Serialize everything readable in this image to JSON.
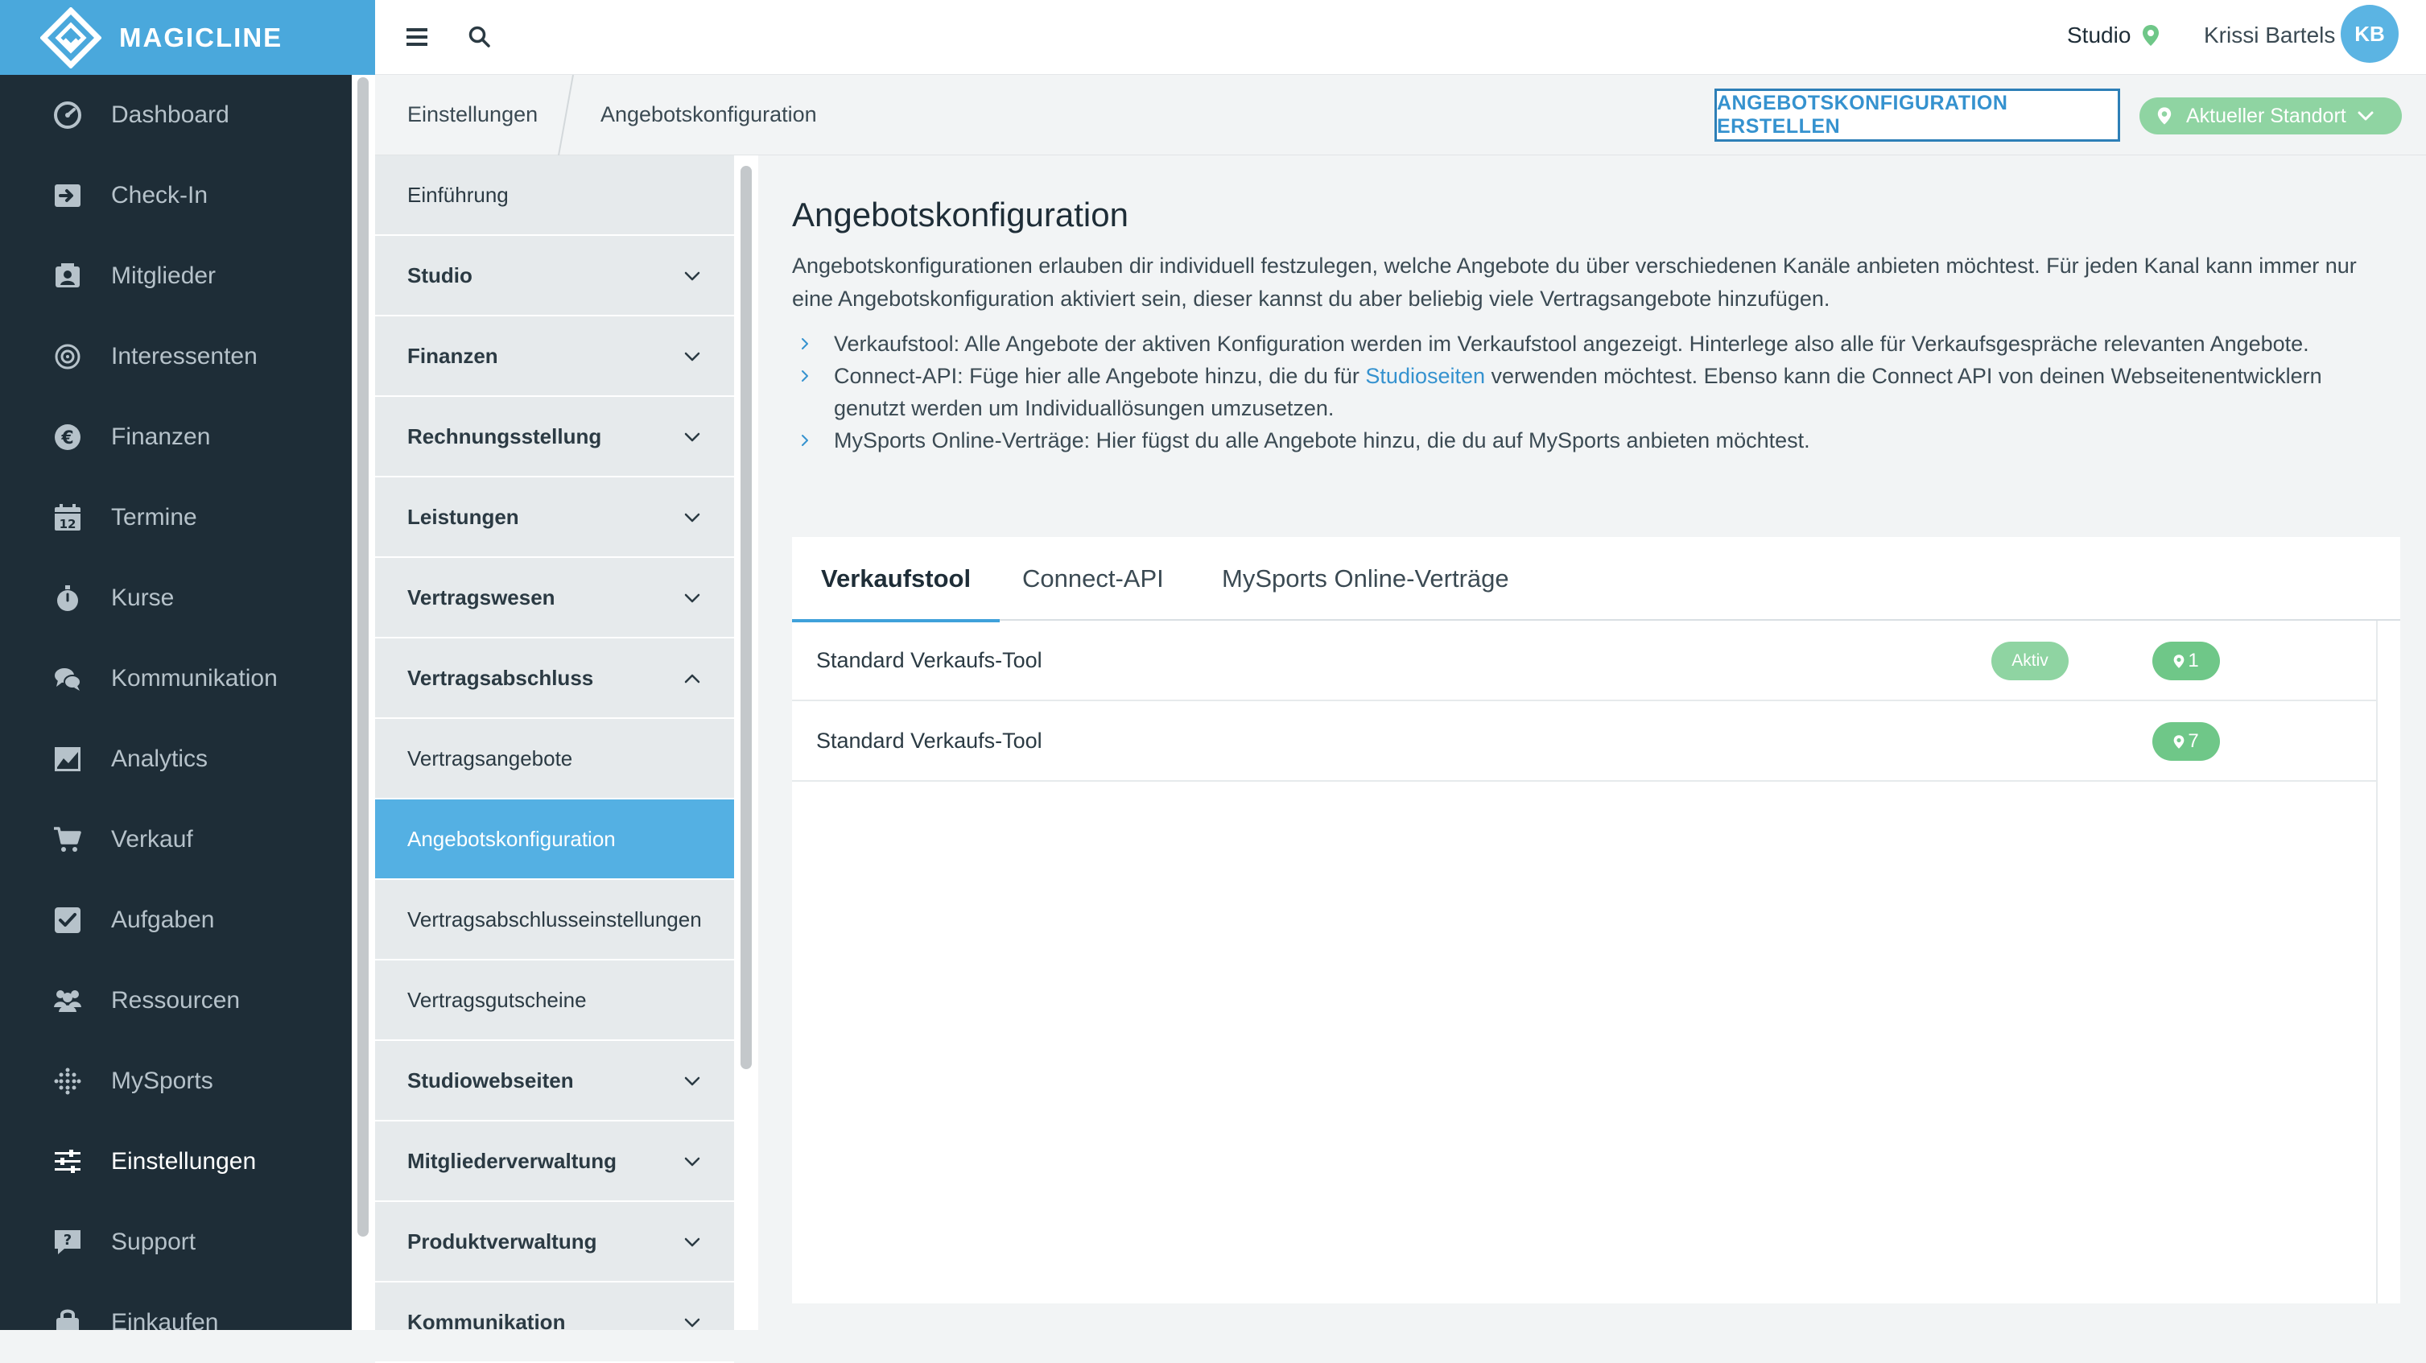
{
  "brand": {
    "name": "MAGICLINE"
  },
  "sidebar": {
    "items": [
      {
        "label": "Dashboard",
        "icon": "dashboard-icon"
      },
      {
        "label": "Check-In",
        "icon": "check-in-icon"
      },
      {
        "label": "Mitglieder",
        "icon": "members-icon"
      },
      {
        "label": "Interessenten",
        "icon": "prospects-icon"
      },
      {
        "label": "Finanzen",
        "icon": "euro-icon"
      },
      {
        "label": "Termine",
        "icon": "calendar-icon"
      },
      {
        "label": "Kurse",
        "icon": "stopwatch-icon"
      },
      {
        "label": "Kommunikation",
        "icon": "chat-icon"
      },
      {
        "label": "Analytics",
        "icon": "analytics-icon"
      },
      {
        "label": "Verkauf",
        "icon": "cart-icon"
      },
      {
        "label": "Aufgaben",
        "icon": "task-check-icon"
      },
      {
        "label": "Ressourcen",
        "icon": "resources-icon"
      },
      {
        "label": "MySports",
        "icon": "mysports-icon"
      },
      {
        "label": "Einstellungen",
        "icon": "settings-sliders-icon"
      },
      {
        "label": "Support",
        "icon": "support-icon"
      },
      {
        "label": "Einkaufen",
        "icon": "shopping-icon"
      }
    ],
    "calendar_day": "12"
  },
  "topbar": {
    "studio_label": "Studio",
    "user_name": "Krissi Bartels",
    "user_initials": "KB"
  },
  "breadcrumb": {
    "parent": "Einstellungen",
    "current": "Angebotskonfiguration"
  },
  "actions": {
    "create_label": "ANGEBOTSKONFIGURATION ERSTELLEN",
    "location_label": "Aktueller Standort"
  },
  "submenu": {
    "items": [
      {
        "label": "Einführung",
        "group": false
      },
      {
        "label": "Studio",
        "group": true,
        "expanded": false
      },
      {
        "label": "Finanzen",
        "group": true,
        "expanded": false
      },
      {
        "label": "Rechnungsstellung",
        "group": true,
        "expanded": false
      },
      {
        "label": "Leistungen",
        "group": true,
        "expanded": false
      },
      {
        "label": "Vertragswesen",
        "group": true,
        "expanded": false
      },
      {
        "label": "Vertragsabschluss",
        "group": true,
        "expanded": true
      },
      {
        "label": "Vertragsangebote",
        "group": false
      },
      {
        "label": "Angebotskonfiguration",
        "group": false,
        "active": true
      },
      {
        "label": "Vertragsabschlusseinstellungen",
        "group": false
      },
      {
        "label": "Vertragsgutscheine",
        "group": false
      },
      {
        "label": "Studiowebseiten",
        "group": true,
        "expanded": false
      },
      {
        "label": "Mitgliederverwaltung",
        "group": true,
        "expanded": false
      },
      {
        "label": "Produktverwaltung",
        "group": true,
        "expanded": false
      },
      {
        "label": "Kommunikation",
        "group": true,
        "expanded": false
      }
    ]
  },
  "page": {
    "title": "Angebotskonfiguration",
    "intro": "Angebotskonfigurationen erlauben dir individuell festzulegen, welche Angebote du über verschiedenen Kanäle anbieten möchtest. Für jeden Kanal kann immer nur eine Angebotskonfiguration aktiviert sein, dieser kannst du aber beliebig viele Vertragsangebote hinzufügen.",
    "bullet1": "Verkaufstool: Alle Angebote der aktiven Konfiguration werden im Verkaufstool angezeigt. Hinterlege also alle für Verkaufsgespräche relevanten Angebote.",
    "bullet2_pre": "Connect-API: Füge hier alle Angebote hinzu, die du für ",
    "bullet2_link": "Studioseiten",
    "bullet2_post": " verwenden möchtest. Ebenso kann die Connect API von deinen Webseitenentwicklern genutzt werden um Individuallösungen umzusetzen.",
    "bullet3": "MySports Online-Verträge: Hier fügst du alle Angebote hinzu, die du auf MySports anbieten möchtest."
  },
  "tabs": [
    {
      "label": "Verkaufstool",
      "active": true
    },
    {
      "label": "Connect-API",
      "active": false
    },
    {
      "label": "MySports Online-Verträge",
      "active": false
    }
  ],
  "rows": [
    {
      "name": "Standard Verkaufs-Tool",
      "status": "Aktiv",
      "locations": "1"
    },
    {
      "name": "Standard Verkaufs-Tool",
      "status": "",
      "locations": "7"
    }
  ],
  "colors": {
    "brand_blue": "#4aa8dc",
    "sidebar_dark": "#1e2d37",
    "active_green": "#8fd4a2",
    "location_green": "#6fc788",
    "active_submenu": "#54b0e3"
  }
}
